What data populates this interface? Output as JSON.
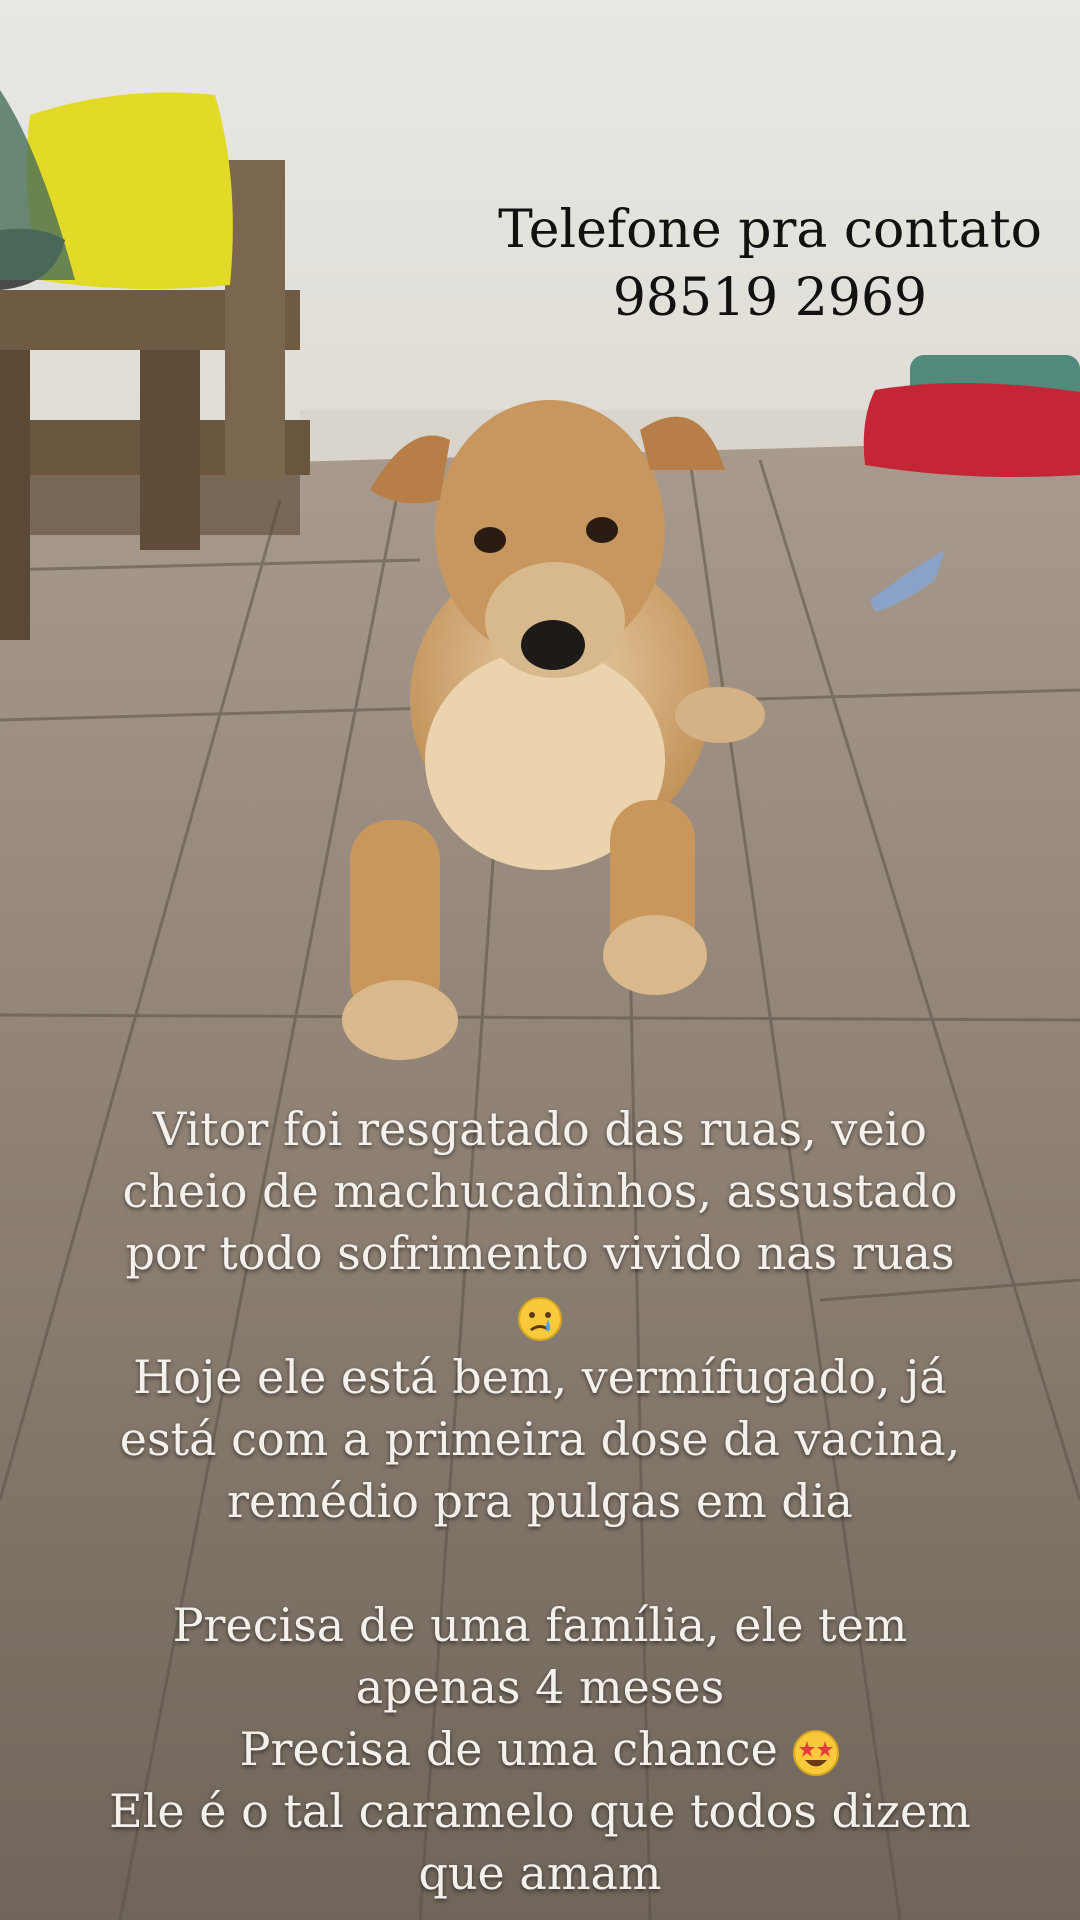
{
  "contact": {
    "label": "Telefone pra contato",
    "phone": "98519 2969"
  },
  "story": {
    "lines_part1": [
      "Vitor foi resgatado das ruas, veio",
      "cheio de machucadinhos, assustado",
      "por todo sofrimento vivido nas ruas"
    ],
    "sad_emoji": "crying-face-emoji",
    "lines_part2": [
      "Hoje ele está bem, vermífugado, já",
      "está com a primeira dose da vacina,",
      "remédio pra pulgas em dia"
    ],
    "lines_part3": [
      "Precisa de uma família, ele tem",
      "apenas 4 meses"
    ],
    "chance_line": "Precisa de uma chance",
    "star_emoji": "star-struck-emoji",
    "lines_part4": [
      "Ele é o tal caramelo que todos dizem",
      "que amam"
    ]
  },
  "colors": {
    "floor": "#8f8173",
    "wall": "#e8e6e0",
    "dog_fur": "#c89b62",
    "pillow_yellow": "#e6dc2a",
    "pillow_red": "#c7253a"
  }
}
